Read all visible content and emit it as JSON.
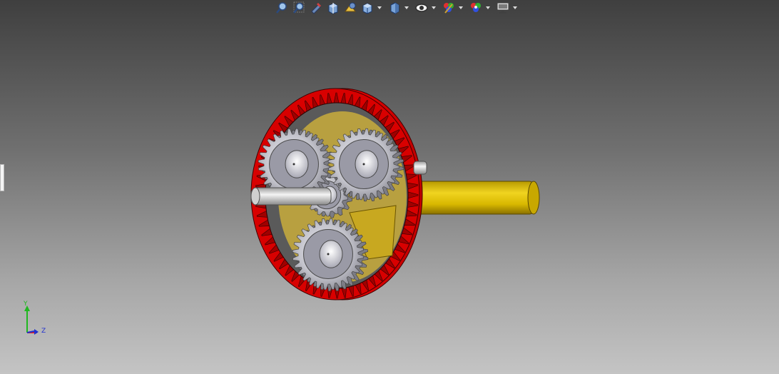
{
  "toolbar": {
    "tools": [
      {
        "name": "zoom-to-fit-icon"
      },
      {
        "name": "zoom-to-area-icon"
      },
      {
        "name": "previous-view-icon"
      },
      {
        "name": "section-view-icon"
      },
      {
        "name": "dynamic-annotation-icon"
      },
      {
        "name": "view-orientation-icon"
      },
      {
        "name": "display-style-icon"
      },
      {
        "name": "hide-show-items-icon"
      },
      {
        "name": "edit-appearance-icon"
      },
      {
        "name": "apply-scene-icon"
      },
      {
        "name": "view-settings-icon"
      }
    ]
  },
  "triad": {
    "y_label": "Y",
    "z_label": "Z",
    "colors": {
      "y": "#1fb81f",
      "x": "#e02020",
      "z": "#2030d0"
    }
  },
  "colors": {
    "ring_gear": "#e00000",
    "shaft": "#e0c000",
    "planet_gear": "#c8c8c8"
  }
}
